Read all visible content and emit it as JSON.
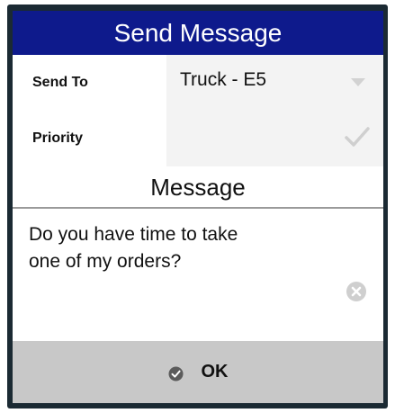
{
  "dialog": {
    "title": "Send Message",
    "send_to": {
      "label": "Send To",
      "value": "Truck - E5",
      "icon": "chevron-down-icon"
    },
    "priority": {
      "label": "Priority",
      "value": "",
      "icon": "checkmark-icon"
    },
    "message": {
      "header": "Message",
      "text": "Do you have time to take\none of my orders?",
      "clear_icon": "clear-icon"
    },
    "ok": {
      "label": "OK",
      "icon": "check-circle-icon"
    }
  },
  "colors": {
    "title_bar": "#0e1a8c",
    "frame": "#1b2a33",
    "ok_bar": "#c8c8c8",
    "value_bg": "#f3f3f3"
  }
}
